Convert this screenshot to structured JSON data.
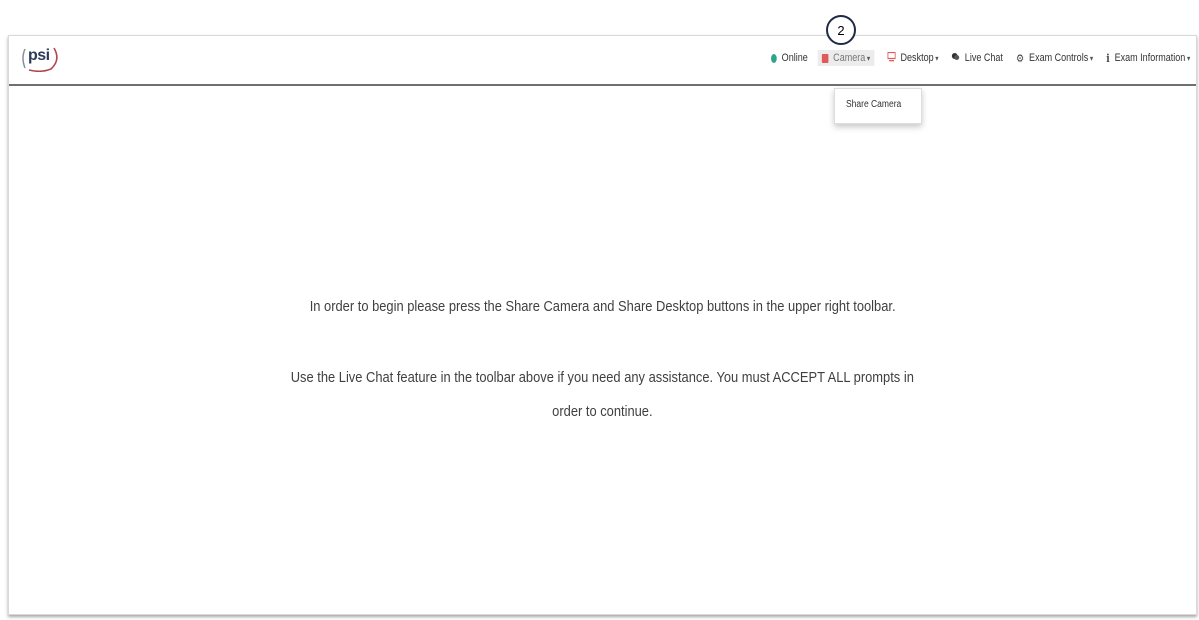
{
  "annotation": {
    "step_number": "2"
  },
  "brand": {
    "logo_text": "psi"
  },
  "navbar": {
    "items": [
      {
        "label": "Online",
        "icon": "status-dot-icon",
        "color": "#2ea58a"
      },
      {
        "label": "Camera",
        "icon": "camera-icon",
        "color": "#e05a5a",
        "caret": "▾",
        "active": true
      },
      {
        "label": "Desktop",
        "icon": "monitor-icon",
        "color": "#e05a5a",
        "caret": "▾"
      },
      {
        "label": "Live Chat",
        "icon": "chat-icon",
        "color": "#333333"
      },
      {
        "label": "Exam Controls",
        "icon": "gear-icon",
        "caret": "▾"
      },
      {
        "label": "Exam Information",
        "icon": "info-icon",
        "caret": "▾"
      }
    ]
  },
  "camera_menu": {
    "items": [
      {
        "label": "Share Camera"
      }
    ]
  },
  "main": {
    "instruction_line1": "In order to begin please press the Share Camera and Share Desktop buttons in the upper right toolbar.",
    "instruction_line2": "Use the Live Chat feature in the toolbar above if you need any assistance. You must ACCEPT ALL prompts in",
    "instruction_line3": "order to continue."
  }
}
